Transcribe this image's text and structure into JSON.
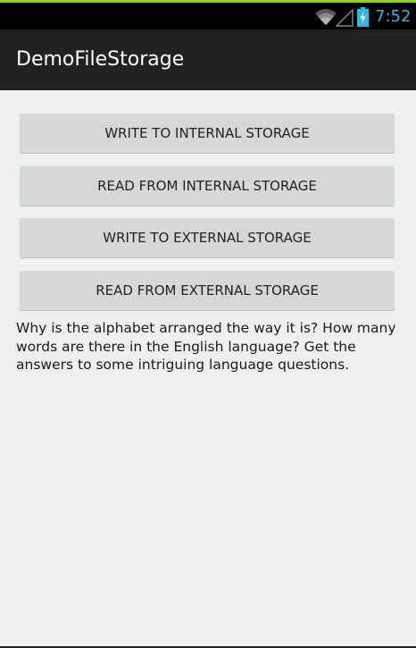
{
  "status_bar": {
    "time": "7:52",
    "icons": [
      "wifi-icon",
      "signal-icon",
      "battery-icon"
    ],
    "clock_color": "#33b5e5"
  },
  "action_bar": {
    "title": "DemoFileStorage"
  },
  "buttons": [
    {
      "label": "WRITE TO INTERNAL STORAGE"
    },
    {
      "label": "READ FROM INTERNAL STORAGE"
    },
    {
      "label": "WRITE TO EXTERNAL STORAGE"
    },
    {
      "label": "READ FROM EXTERNAL STORAGE"
    }
  ],
  "body_text": "Why is the alphabet arranged the way it is? How many words are there in the English language? Get the answers to some intriguing language questions.",
  "colors": {
    "accent": "#33b5e5",
    "button_bg": "#d6d7d7",
    "content_bg": "#efefef",
    "action_bar_bg": "#222222"
  }
}
